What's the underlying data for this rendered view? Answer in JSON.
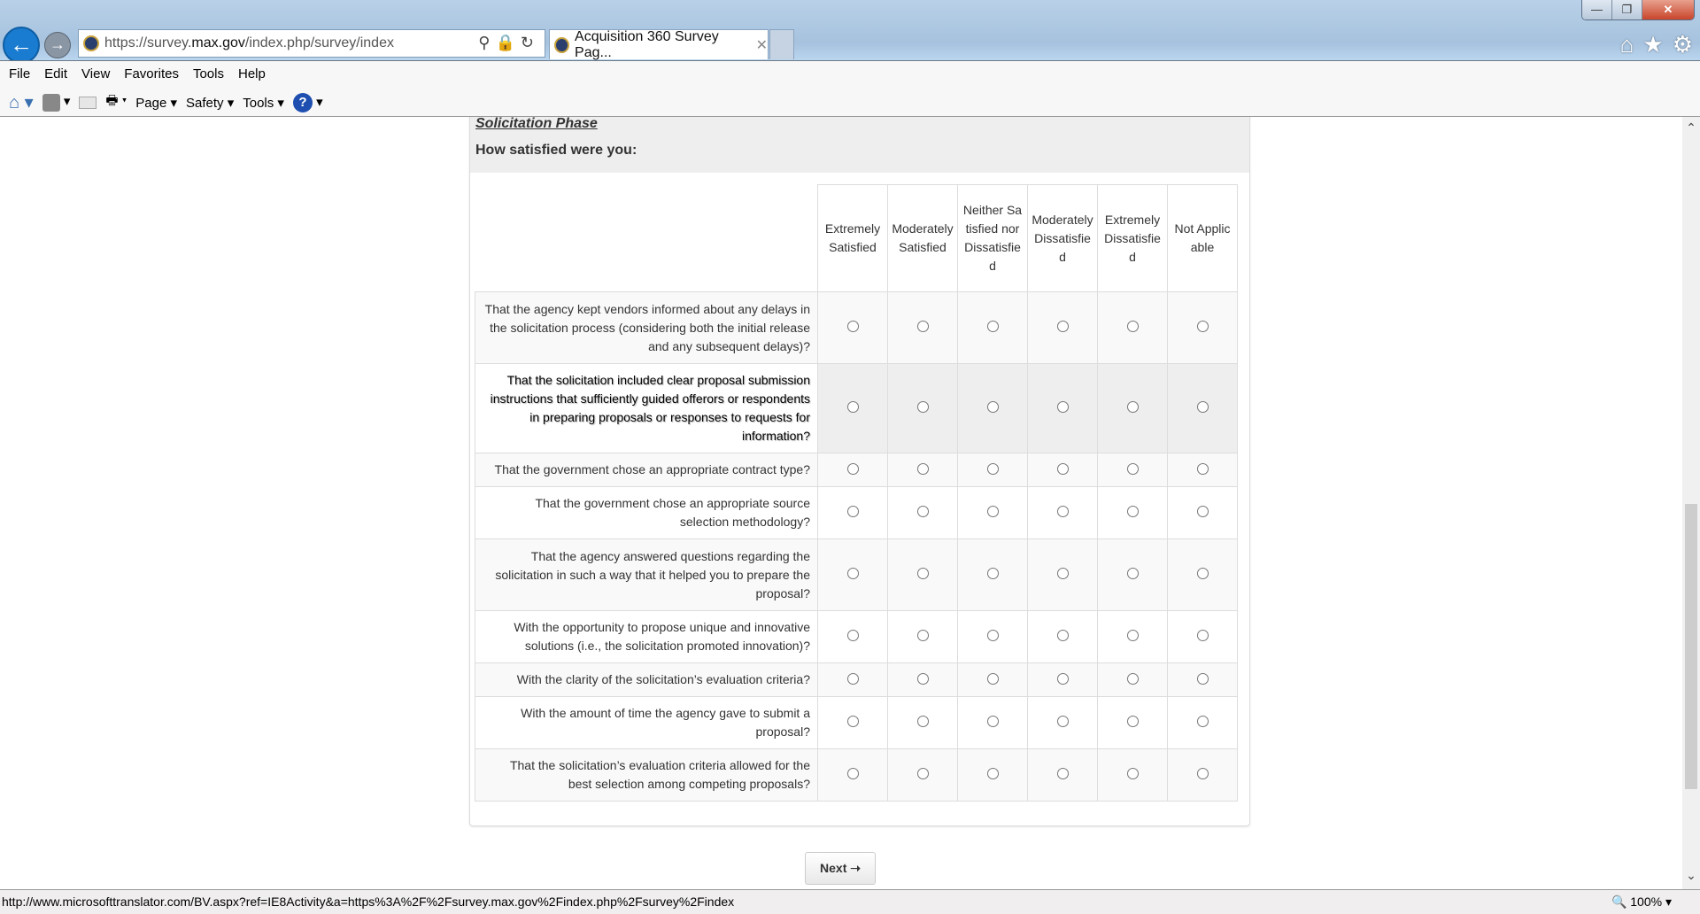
{
  "browser": {
    "url_prefix": "https://survey.",
    "url_domain": "max.gov",
    "url_path": "/index.php/survey/index",
    "tab_title": "Acquisition 360 Survey Pag...",
    "menu": [
      "File",
      "Edit",
      "View",
      "Favorites",
      "Tools",
      "Help"
    ],
    "command_bar": {
      "page": "Page ▾",
      "safety": "Safety ▾",
      "tools": "Tools ▾"
    },
    "status_url": "http://www.microsofttranslator.com/BV.aspx?ref=IE8Activity&a=https%3A%2F%2Fsurvey.max.gov%2Findex.php%2Fsurvey%2Findex",
    "zoom": "100%"
  },
  "survey": {
    "phase": "Solicitation Phase",
    "question": "How satisfied were you:",
    "columns": [
      "Extremely Satisfied",
      "Moderately Satisfied",
      "Neither Satisfied nor Dissatisfied",
      "Moderately Dissatisfied",
      "Extremely Dissatisfied",
      "Not Applicable"
    ],
    "rows": [
      "That the agency kept vendors informed about any delays in the solicitation process (considering both the initial release and any subsequent delays)?",
      "That the solicitation included clear proposal submission instructions that sufficiently guided offerors or respondents in preparing proposals or responses to requests for information?",
      "That the government chose an appropriate contract type?",
      "That the government chose an appropriate source selection methodology?",
      "That the agency answered questions regarding the solicitation in such a way that it helped you to prepare the proposal?",
      "With the opportunity to propose unique and innovative solutions (i.e., the solicitation promoted innovation)?",
      "With the clarity of the solicitation’s evaluation criteria?",
      "With the amount of time the agency gave to submit a proposal?",
      "That the solicitation’s evaluation criteria allowed for the best selection among competing proposals?"
    ],
    "next_label": "Next ➝"
  }
}
